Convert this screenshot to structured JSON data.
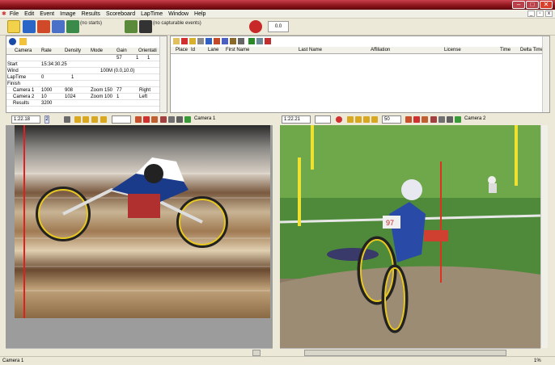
{
  "window": {
    "min": "–",
    "max": "□",
    "close": "✕"
  },
  "menu": [
    "File",
    "Edit",
    "Event",
    "Image",
    "Results",
    "Scoreboard",
    "LapTime",
    "Window",
    "Help"
  ],
  "toolbar": {
    "no_starts": "(no starts)",
    "no_events": "(no capturable events)",
    "counter": "0.0"
  },
  "left": {
    "columns": [
      "Camera",
      "Rate",
      "Density",
      "Mode",
      "Gain",
      "Orientati"
    ],
    "top_values": [
      "57",
      "1",
      "1"
    ],
    "rows": [
      {
        "label": "Start",
        "c1": "15:34:30.25",
        "c2": "",
        "c3": "",
        "c4": "",
        "c5": ""
      },
      {
        "label": "Wind",
        "c1": "",
        "c2": "",
        "c3": "100M (0.0,10.0)",
        "c4": "",
        "c5": ""
      },
      {
        "label": "LapTime",
        "c1": "0",
        "c2": "1",
        "c3": "",
        "c4": "",
        "c5": ""
      },
      {
        "label": "Finish",
        "c1": "",
        "c2": "",
        "c3": "",
        "c4": "",
        "c5": ""
      },
      {
        "label": "Camera 1",
        "c1": "1000",
        "c2": "908",
        "c3": "Zoom 150",
        "c4": "77",
        "c5": "Right"
      },
      {
        "label": "Camera 2",
        "c1": "10",
        "c2": "1024",
        "c3": "Zoom 100",
        "c4": "1",
        "c5": "Left"
      },
      {
        "label": "Results",
        "c1": "3200",
        "c2": "",
        "c3": "",
        "c4": "",
        "c5": ""
      }
    ]
  },
  "right": {
    "columns": [
      "Place",
      "Id",
      "Lane",
      "First Name",
      "Last Name",
      "Affiliation",
      "License",
      "Time",
      "Delta Time"
    ]
  },
  "cam1": {
    "time": "1:22.18",
    "spin": "2",
    "label": "Camera 1"
  },
  "cam2": {
    "time": "1:22.21",
    "zoom": "50",
    "label": "Camera 2",
    "bib": "97"
  },
  "status": {
    "left": "Camera 1",
    "right": "1%"
  }
}
